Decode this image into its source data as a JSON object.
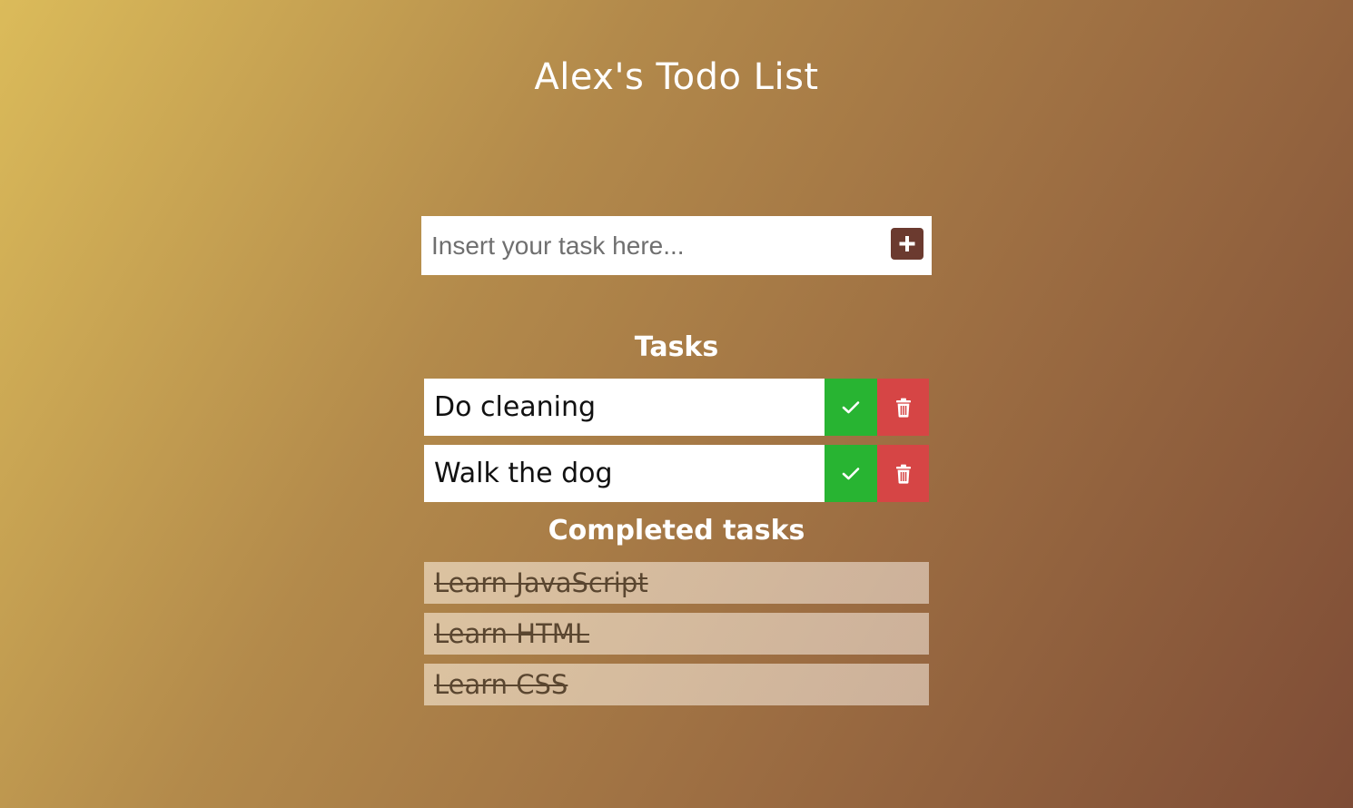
{
  "app": {
    "title": "Alex's Todo List"
  },
  "new_task": {
    "placeholder": "Insert your task here...",
    "value": "",
    "add_icon": "plus-icon"
  },
  "tasks": {
    "heading": "Tasks",
    "items": [
      {
        "label": "Do cleaning",
        "complete_icon": "check-icon",
        "delete_icon": "trash-icon"
      },
      {
        "label": "Walk the dog",
        "complete_icon": "check-icon",
        "delete_icon": "trash-icon"
      }
    ]
  },
  "completed": {
    "heading": "Completed tasks",
    "items": [
      {
        "label": "Learn JavaScript"
      },
      {
        "label": "Learn HTML"
      },
      {
        "label": "Learn CSS"
      }
    ]
  },
  "colors": {
    "complete": "#28b432",
    "delete": "#d64545",
    "add_button": "#6b3a2f"
  }
}
